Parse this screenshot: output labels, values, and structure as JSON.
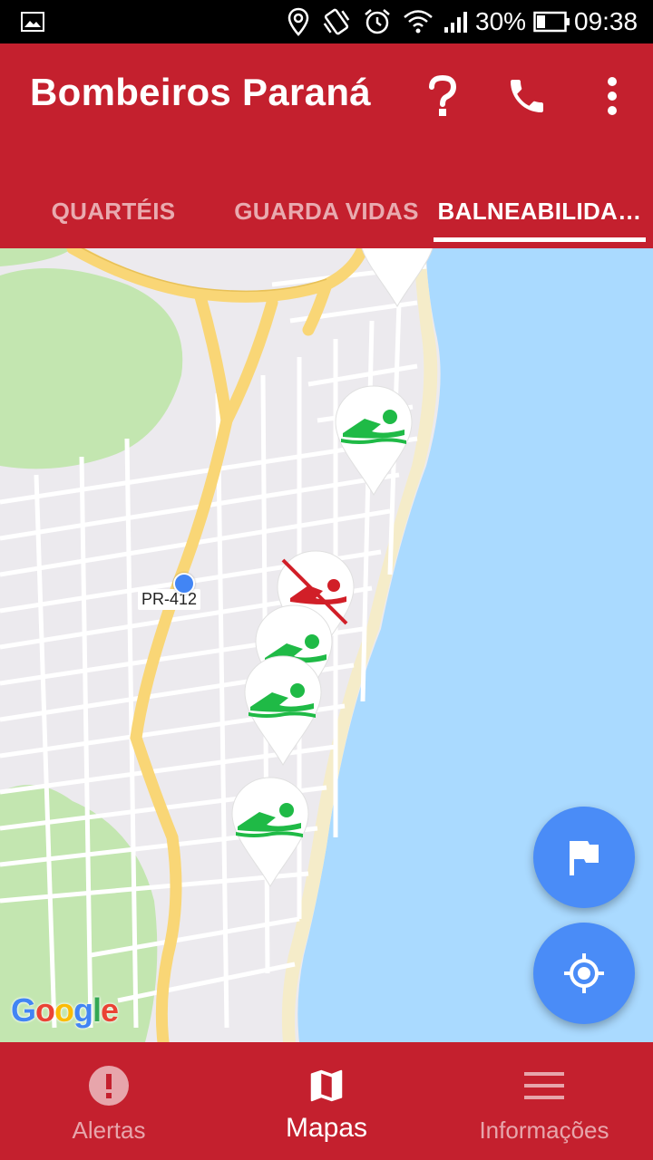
{
  "status_bar": {
    "battery_percent": "30%",
    "time": "09:38",
    "icons": [
      "image-notification-icon",
      "location-icon",
      "vibrate-icon",
      "alarm-icon",
      "wifi-icon",
      "signal-icon",
      "battery-icon"
    ]
  },
  "app_bar": {
    "title": "Bombeiros Paraná",
    "actions": [
      "help-icon",
      "phone-icon",
      "overflow-menu-icon"
    ]
  },
  "tabs": [
    {
      "label": "QUARTÉIS",
      "active": false
    },
    {
      "label": "GUARDA VIDAS",
      "active": false
    },
    {
      "label": "BALNEABILIDA…",
      "active": true
    }
  ],
  "map": {
    "road_label": "PR-412",
    "markers": [
      {
        "type": "swim-allowed",
        "color": "#1fba46"
      },
      {
        "type": "swim-allowed",
        "color": "#1fba46"
      },
      {
        "type": "swim-forbidden",
        "color": "#d11f28"
      },
      {
        "type": "swim-allowed",
        "color": "#1fba46"
      },
      {
        "type": "swim-allowed",
        "color": "#1fba46"
      },
      {
        "type": "swim-allowed",
        "color": "#1fba46"
      }
    ],
    "attribution": "Google",
    "colors": {
      "water": "#aadaff",
      "land": "#eceaee",
      "park": "#c3e6b0",
      "highway": "#f9d676"
    }
  },
  "fabs": [
    "flag-icon",
    "my-location-icon"
  ],
  "bottom_nav": [
    {
      "label": "Alertas",
      "icon": "alert-icon",
      "active": false
    },
    {
      "label": "Mapas",
      "icon": "map-icon",
      "active": true
    },
    {
      "label": "Informações",
      "icon": "menu-icon",
      "active": false
    }
  ],
  "theme": {
    "primary": "#c4202e",
    "fab": "#4a8cf7"
  }
}
